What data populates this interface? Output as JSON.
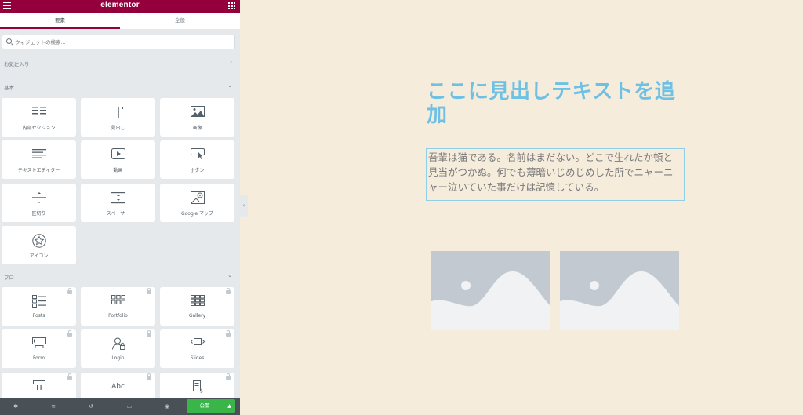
{
  "app": {
    "title": "elementor"
  },
  "tabs": [
    {
      "label": "要素",
      "active": true
    },
    {
      "label": "全般",
      "active": false
    }
  ],
  "search": {
    "placeholder": "ウィジェットの検索..."
  },
  "sections": {
    "favorites": "お気に入り",
    "basic": "基本",
    "pro": "プロ"
  },
  "basic_widgets": [
    {
      "label": "内部セクション",
      "icon": "inner-section-icon"
    },
    {
      "label": "見出し",
      "icon": "heading-icon"
    },
    {
      "label": "画像",
      "icon": "image-icon"
    },
    {
      "label": "テキストエディター",
      "icon": "text-editor-icon"
    },
    {
      "label": "動画",
      "icon": "video-icon"
    },
    {
      "label": "ボタン",
      "icon": "button-icon"
    },
    {
      "label": "区切り",
      "icon": "divider-icon"
    },
    {
      "label": "スペーサー",
      "icon": "spacer-icon"
    },
    {
      "label": "Google マップ",
      "icon": "google-maps-icon"
    },
    {
      "label": "アイコン",
      "icon": "star-icon"
    }
  ],
  "pro_widgets": [
    {
      "label": "Posts",
      "icon": "posts-icon"
    },
    {
      "label": "Portfolio",
      "icon": "portfolio-icon"
    },
    {
      "label": "Gallery",
      "icon": "gallery-icon"
    },
    {
      "label": "Form",
      "icon": "form-icon"
    },
    {
      "label": "Login",
      "icon": "login-icon"
    },
    {
      "label": "Slides",
      "icon": "slides-icon"
    },
    {
      "label": "",
      "icon": "nav-menu-icon"
    },
    {
      "label": "",
      "icon": "animated-headline-icon"
    },
    {
      "label": "",
      "icon": "price-list-icon"
    }
  ],
  "bottombar": {
    "publish_label": "公開"
  },
  "canvas": {
    "heading": "ここに見出しテキストを追加",
    "paragraph": "吾輩は猫である。名前はまだない。どこで生れたか頓と見当がつかぬ。何でも薄暗いじめじめした所でニャーニャー泣いていた事だけは記憶している。"
  },
  "colors": {
    "brand": "#93003c",
    "heading": "#6ec1e4",
    "canvas_bg": "#f5ecdc",
    "publish": "#39b54a"
  }
}
